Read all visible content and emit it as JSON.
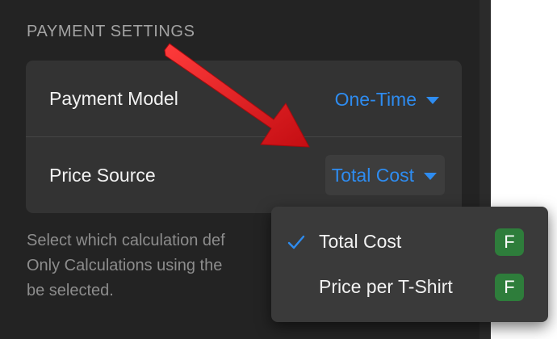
{
  "payment_settings": {
    "section_title": "PAYMENT SETTINGS",
    "rows": [
      {
        "label": "Payment Model",
        "value": "One-Time"
      },
      {
        "label": "Price Source",
        "value": "Total Cost"
      }
    ],
    "help_lines": [
      "Select which calculation def",
      "Only Calculations using the",
      "be selected."
    ]
  },
  "dropdown": {
    "selected": "Total Cost",
    "options": [
      {
        "label": "Total Cost",
        "badge": "F",
        "checked": true
      },
      {
        "label": "Price per T-Shirt",
        "badge": "F",
        "checked": false
      }
    ]
  },
  "colors": {
    "panel_bg": "#232323",
    "card_bg": "#333333",
    "accent_blue": "#2e8cf0",
    "badge_green": "#2e7d3b",
    "annotation_arrow": "#e3141b"
  },
  "icons": {
    "caret": "chevron-down-icon",
    "check": "checkmark-icon",
    "annotation": "red-arrow-icon"
  }
}
